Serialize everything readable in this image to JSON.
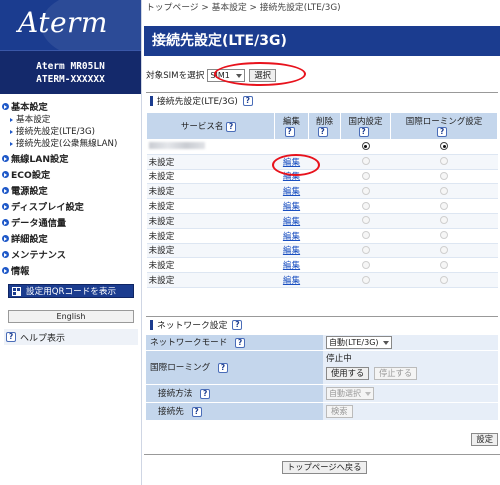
{
  "sidebar": {
    "logo": "Aterm",
    "model_line1": "Aterm MR05LN",
    "model_line2": "ATERM-XXXXXX",
    "menu": [
      {
        "label": "基本設定",
        "subs": [
          "基本設定",
          "接続先設定(LTE/3G)",
          "接続先設定(公衆無線LAN)"
        ]
      },
      {
        "label": "無線LAN設定"
      },
      {
        "label": "ECO設定"
      },
      {
        "label": "電源設定"
      },
      {
        "label": "ディスプレイ設定"
      },
      {
        "label": "データ通信量"
      },
      {
        "label": "詳細設定"
      },
      {
        "label": "メンテナンス"
      },
      {
        "label": "情報"
      }
    ],
    "qr_button": "設定用QRコードを表示",
    "english_button": "English",
    "help_label": "ヘルプ表示"
  },
  "main": {
    "breadcrumb": "トップページ > 基本設定 > 接続先設定(LTE/3G)",
    "title": "接続先設定(LTE/3G)",
    "sim_label": "対象SIMを選択",
    "sim_value": "SIM1",
    "select_button": "選択",
    "section1_title": "接続先設定(LTE/3G)",
    "table_headers": {
      "service": "サービス名",
      "edit": "編集",
      "delete": "削除",
      "domestic": "国内設定",
      "roaming": "国際ローミング設定"
    },
    "rows": [
      {
        "service": "",
        "edit": ""
      },
      {
        "service": "未設定",
        "edit": "編集"
      },
      {
        "service": "未設定",
        "edit": "編集"
      },
      {
        "service": "未設定",
        "edit": "編集"
      },
      {
        "service": "未設定",
        "edit": "編集"
      },
      {
        "service": "未設定",
        "edit": "編集"
      },
      {
        "service": "未設定",
        "edit": "編集"
      },
      {
        "service": "未設定",
        "edit": "編集"
      },
      {
        "service": "未設定",
        "edit": "編集"
      },
      {
        "service": "未設定",
        "edit": "編集"
      }
    ],
    "section2_title": "ネットワーク設定",
    "network": {
      "mode_label": "ネットワークモード",
      "mode_value": "自動(LTE/3G)",
      "roaming_label": "国際ローミング",
      "roaming_status": "停止中",
      "use_button": "使用する",
      "stop_button": "停止する",
      "method_label": "接続方法",
      "method_value": "自動選択",
      "dest_label": "接続先",
      "search_button": "検索"
    },
    "settings_button": "設定",
    "back_button": "トップページへ戻る"
  },
  "colors": {
    "brand": "#1b3c8f",
    "highlight": "#e8121c",
    "header": "#c4d6ec"
  }
}
